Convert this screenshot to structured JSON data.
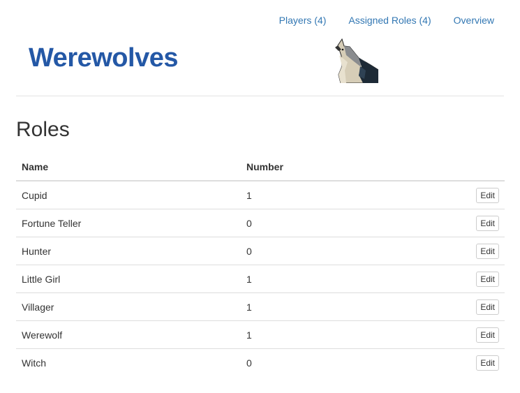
{
  "nav": {
    "players": "Players (4)",
    "assigned_roles": "Assigned Roles (4)",
    "overview": "Overview"
  },
  "brand": {
    "title": "Werewolves",
    "color": "#2458a6",
    "logo_icon": "howling-wolf-icon"
  },
  "page": {
    "title": "Roles"
  },
  "table": {
    "headers": [
      "Name",
      "Number",
      ""
    ],
    "rows": [
      {
        "name": "Cupid",
        "number": "1",
        "action": "Edit"
      },
      {
        "name": "Fortune Teller",
        "number": "0",
        "action": "Edit"
      },
      {
        "name": "Hunter",
        "number": "0",
        "action": "Edit"
      },
      {
        "name": "Little Girl",
        "number": "1",
        "action": "Edit"
      },
      {
        "name": "Villager",
        "number": "1",
        "action": "Edit"
      },
      {
        "name": "Werewolf",
        "number": "1",
        "action": "Edit"
      },
      {
        "name": "Witch",
        "number": "0",
        "action": "Edit"
      }
    ]
  },
  "colors": {
    "link": "#3277b3",
    "text": "#333333",
    "border": "#dddddd"
  }
}
